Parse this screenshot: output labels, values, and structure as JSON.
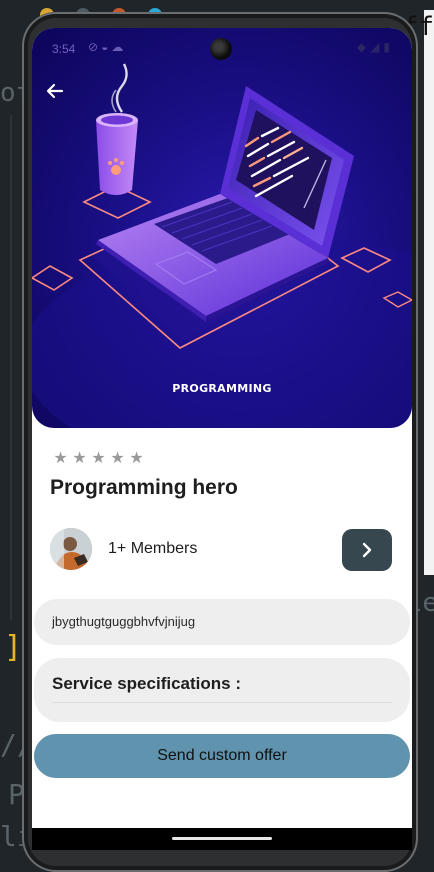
{
  "status_bar": {
    "time": "3:54",
    "left_icons": [
      "do-not-disturb-icon",
      "data-saver-icon",
      "cloud-icon"
    ],
    "right_icons": [
      "wifi-icon",
      "signal-icon",
      "battery-icon"
    ]
  },
  "hero": {
    "caption": "PROGRAMMING",
    "back_icon": "arrow-left-icon"
  },
  "rating": {
    "value": 0,
    "max": 5
  },
  "title": "Programming hero",
  "members": {
    "label": "1+ Members",
    "next_icon": "chevron-right-icon"
  },
  "description_field": {
    "value": "jbygthugtguggbhvfvjnijug"
  },
  "service_spec": {
    "label": "Service specifications :"
  },
  "actions": {
    "send_offer_label": "Send custom offer"
  },
  "colors": {
    "accent": "#6093ae",
    "next_button": "#37474f",
    "field_bg": "#eeeeee",
    "hero_bg": "#1a0f86"
  },
  "backdrop": {
    "glyph_of": "of",
    "glyph_bracket": "]",
    "glyph_slashes": "//",
    "glyph_p": "P",
    "glyph_li": "li",
    "glyph_ff": "ff",
    "glyph_le": "le"
  }
}
